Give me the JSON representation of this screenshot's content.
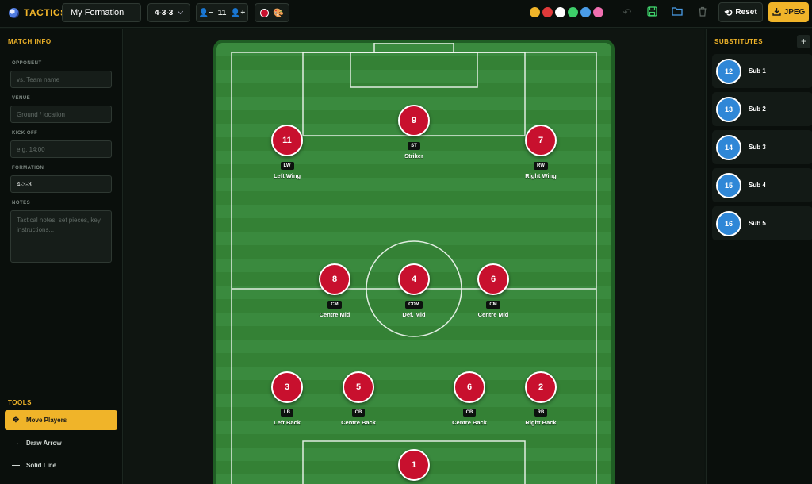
{
  "app": {
    "title": "TACTICS"
  },
  "toolbar": {
    "formation_name": "My Formation",
    "formation": "4-3-3",
    "player_count": "11",
    "team_color": "#c8102e",
    "swatches": [
      "#f0b429",
      "#e03a3a",
      "#ffffff",
      "#3ecf6a",
      "#4a9de8",
      "#f06fb0"
    ],
    "reset_label": "Reset",
    "export_label": "JPEG"
  },
  "match_info": {
    "title": "MATCH INFO",
    "opponent_label": "OPPONENT",
    "opponent_placeholder": "vs. Team name",
    "venue_label": "VENUE",
    "venue_placeholder": "Ground / location",
    "kickoff_label": "KICK OFF",
    "kickoff_placeholder": "e.g. 14:00",
    "formation_label": "FORMATION",
    "formation_value": "4-3-3",
    "notes_label": "NOTES",
    "notes_placeholder": "Tactical notes, set pieces, key instructions..."
  },
  "tools": {
    "title": "TOOLS",
    "items": [
      {
        "label": "Move Players",
        "icon": "move-icon"
      },
      {
        "label": "Draw Arrow",
        "icon": "arrow-icon"
      },
      {
        "label": "Solid Line",
        "icon": "line-icon"
      }
    ]
  },
  "players": [
    {
      "number": "9",
      "position": "ST",
      "name": "Striker"
    },
    {
      "number": "11",
      "position": "LW",
      "name": "Left Wing"
    },
    {
      "number": "7",
      "position": "RW",
      "name": "Right Wing"
    },
    {
      "number": "8",
      "position": "CM",
      "name": "Centre Mid"
    },
    {
      "number": "4",
      "position": "CDM",
      "name": "Def. Mid"
    },
    {
      "number": "6",
      "position": "CM",
      "name": "Centre Mid"
    },
    {
      "number": "3",
      "position": "LB",
      "name": "Left Back"
    },
    {
      "number": "5",
      "position": "CB",
      "name": "Centre Back"
    },
    {
      "number": "6",
      "position": "CB",
      "name": "Centre Back"
    },
    {
      "number": "2",
      "position": "RB",
      "name": "Right Back"
    },
    {
      "number": "1",
      "position": "",
      "name": ""
    }
  ],
  "substitutes": {
    "title": "SUBSTITUTES",
    "items": [
      {
        "number": "12",
        "name": "Sub 1"
      },
      {
        "number": "13",
        "name": "Sub 2"
      },
      {
        "number": "14",
        "name": "Sub 3"
      },
      {
        "number": "15",
        "name": "Sub 4"
      },
      {
        "number": "16",
        "name": "Sub 5"
      }
    ]
  }
}
